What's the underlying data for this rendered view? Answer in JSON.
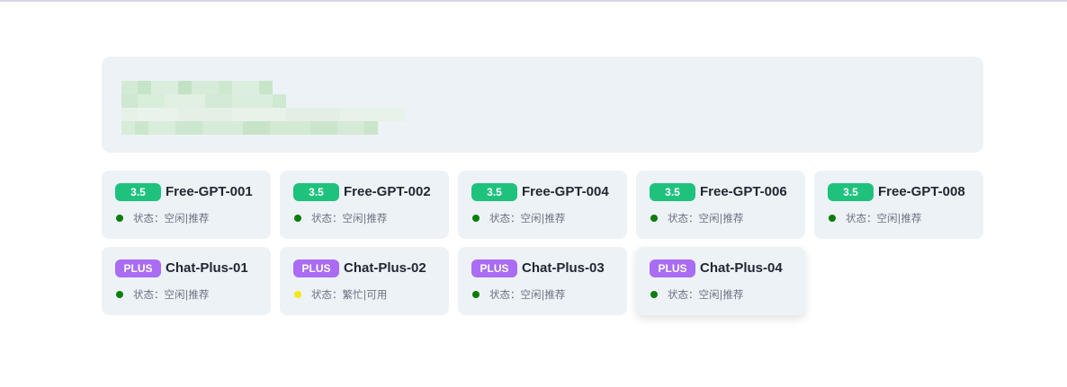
{
  "colors": {
    "badge_35": "#1ec27c",
    "badge_plus": "#a96cf2",
    "status_idle": "#0b7d0b",
    "status_busy": "#f5e617",
    "card_bg": "#edf2f7"
  },
  "cards": [
    {
      "badge": "3.5",
      "badge_type": "35",
      "title": "Free-GPT-001",
      "status": "状态：空闲|推荐",
      "status_level": "idle"
    },
    {
      "badge": "3.5",
      "badge_type": "35",
      "title": "Free-GPT-002",
      "status": "状态：空闲|推荐",
      "status_level": "idle"
    },
    {
      "badge": "3.5",
      "badge_type": "35",
      "title": "Free-GPT-004",
      "status": "状态：空闲|推荐",
      "status_level": "idle"
    },
    {
      "badge": "3.5",
      "badge_type": "35",
      "title": "Free-GPT-006",
      "status": "状态：空闲|推荐",
      "status_level": "idle"
    },
    {
      "badge": "3.5",
      "badge_type": "35",
      "title": "Free-GPT-008",
      "status": "状态：空闲|推荐",
      "status_level": "idle"
    },
    {
      "badge": "PLUS",
      "badge_type": "plus",
      "title": "Chat-Plus-01",
      "status": "状态：空闲|推荐",
      "status_level": "idle"
    },
    {
      "badge": "PLUS",
      "badge_type": "plus",
      "title": "Chat-Plus-02",
      "status": "状态：繁忙|可用",
      "status_level": "busy"
    },
    {
      "badge": "PLUS",
      "badge_type": "plus",
      "title": "Chat-Plus-03",
      "status": "状态：空闲|推荐",
      "status_level": "idle"
    },
    {
      "badge": "PLUS",
      "badge_type": "plus",
      "title": "Chat-Plus-04",
      "status": "状态：空闲|推荐",
      "status_level": "idle"
    }
  ]
}
